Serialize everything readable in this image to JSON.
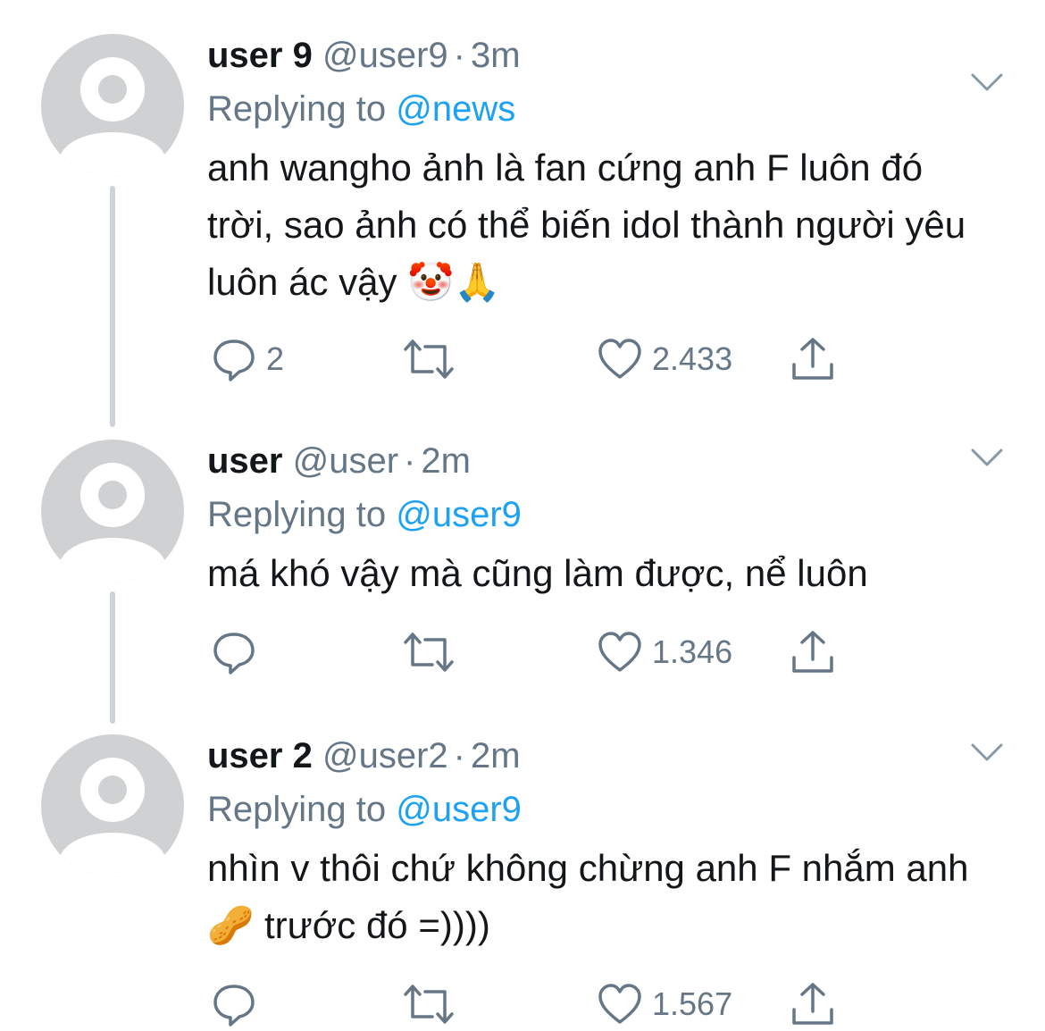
{
  "colors": {
    "text": "#14171a",
    "secondary": "#657786",
    "link": "#1da1f2",
    "avatar": "#cfd1d3",
    "thread_line": "#cdd3d8"
  },
  "icons": {
    "reply": "reply-icon",
    "retweet": "retweet-icon",
    "like": "like-icon",
    "share": "share-icon",
    "more": "chevron-down-icon",
    "avatar": "default-avatar-icon"
  },
  "tweets": [
    {
      "name": "user 9",
      "handle": "@user9",
      "dot": "·",
      "time": "3m",
      "replying_prefix": "Replying to ",
      "replying_to": "@news",
      "text": "anh wangho ảnh là fan cứng anh F luôn đó trời, sao ảnh có thể biến idol thành người yêu luôn ác vậy 🤡🙏",
      "reply_count": "2",
      "like_count": "2.433"
    },
    {
      "name": "user",
      "handle": "@user",
      "dot": "·",
      "time": "2m",
      "replying_prefix": "Replying to ",
      "replying_to": "@user9",
      "text": "má khó vậy mà cũng làm được, nể luôn",
      "reply_count": "",
      "like_count": "1.346"
    },
    {
      "name": "user 2",
      "handle": "@user2",
      "dot": "·",
      "time": "2m",
      "replying_prefix": "Replying to ",
      "replying_to": "@user9",
      "text": "nhìn v thôi chứ không chừng anh F nhắm anh 🥜 trước đó =))))",
      "reply_count": "",
      "like_count": "1.567"
    }
  ]
}
